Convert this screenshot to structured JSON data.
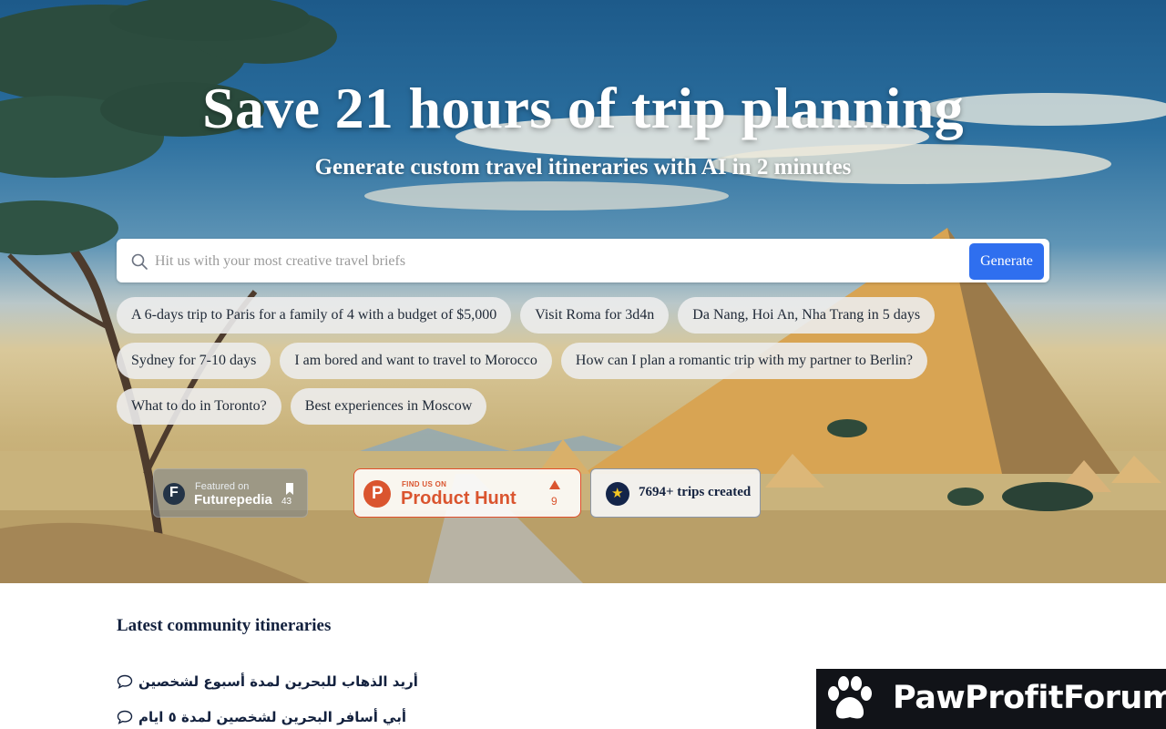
{
  "hero": {
    "title": "Save 21 hours of trip planning",
    "subtitle": "Generate custom travel itineraries with AI in 2 minutes"
  },
  "search": {
    "placeholder": "Hit us with your most creative travel briefs",
    "value": "",
    "button_label": "Generate"
  },
  "suggestions": [
    [
      "A 6-days trip to Paris for a family of 4 with a budget of $5,000",
      "Visit Roma for 3d4n",
      "Da Nang, Hoi An, Nha Trang in 5 days"
    ],
    [
      "Sydney for 7-10 days",
      "I am bored and want to travel to Morocco",
      "How can I plan a romantic trip with my partner to Berlin?"
    ],
    [
      "What to do in Toronto?",
      "Best experiences in Moscow"
    ]
  ],
  "badges": {
    "futurepedia": {
      "small": "Featured on",
      "name": "Futurepedia",
      "count": "43"
    },
    "product_hunt": {
      "small": "FIND US ON",
      "name": "Product Hunt",
      "count": "9"
    },
    "trips": {
      "label": "7694+ trips created"
    }
  },
  "community": {
    "title": "Latest community itineraries",
    "items": [
      "أريد الذهاب للبحرين لمدة أسبوع لشخصين",
      "أبي أسافر البحرين لشخصين لمدة ٥ ايام"
    ]
  },
  "watermark": {
    "text": "PawProfitForum"
  },
  "colors": {
    "accent": "#2f6fef",
    "product_hunt": "#da552f",
    "navy": "#13213e"
  },
  "icons": {
    "search": "search-icon",
    "chat": "chat-bubble-icon",
    "star": "star-icon",
    "bookmark": "bookmark-icon",
    "upvote": "upvote-arrow-icon",
    "paw": "paw-icon"
  }
}
